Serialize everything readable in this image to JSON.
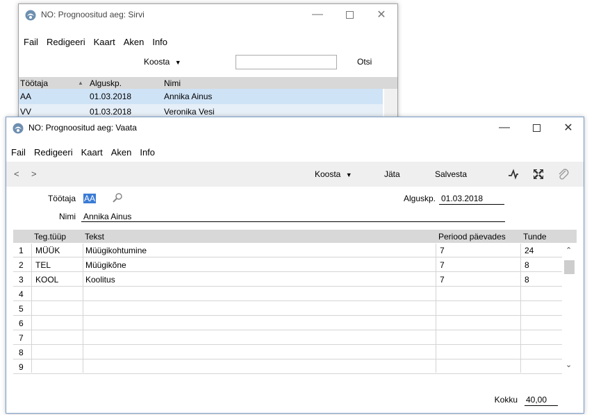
{
  "browse_window": {
    "title": "NO: Prognoositud aeg: Sirvi",
    "menu": [
      "Fail",
      "Redigeeri",
      "Kaart",
      "Aken",
      "Info"
    ],
    "collect_label": "Koosta",
    "search_value": "",
    "search_button": "Otsi",
    "columns": [
      "Töötaja",
      "Alguskp.",
      "Nimi"
    ],
    "rows": [
      {
        "code": "AA",
        "date": "01.03.2018",
        "name": "Annika Ainus"
      },
      {
        "code": "VV",
        "date": "01.03.2018",
        "name": "Veronika Vesi"
      }
    ]
  },
  "view_window": {
    "title": "NO: Prognoositud aeg: Vaata",
    "menu": [
      "Fail",
      "Redigeeri",
      "Kaart",
      "Aken",
      "Info"
    ],
    "toolbar": {
      "prev": "<",
      "next": ">",
      "collect_label": "Koosta",
      "discard_label": "Jäta",
      "save_label": "Salvesta"
    },
    "fields": {
      "employee_label": "Töötaja",
      "employee_value": "AA",
      "start_label": "Alguskp.",
      "start_value": "01.03.2018",
      "name_label": "Nimi",
      "name_value": "Annika Ainus"
    },
    "grid": {
      "columns": [
        "",
        "Teg.tüüp",
        "Tekst",
        "Periood päevades",
        "Tunde"
      ],
      "rows": [
        {
          "n": "1",
          "type": "MÜÜK",
          "text": "Müügikohtumine",
          "period": "7",
          "hours": "24"
        },
        {
          "n": "2",
          "type": "TEL",
          "text": "Müügikõne",
          "period": "7",
          "hours": "8"
        },
        {
          "n": "3",
          "type": "KOOL",
          "text": "Koolitus",
          "period": "7",
          "hours": "8"
        },
        {
          "n": "4",
          "type": "",
          "text": "",
          "period": "",
          "hours": ""
        },
        {
          "n": "5",
          "type": "",
          "text": "",
          "period": "",
          "hours": ""
        },
        {
          "n": "6",
          "type": "",
          "text": "",
          "period": "",
          "hours": ""
        },
        {
          "n": "7",
          "type": "",
          "text": "",
          "period": "",
          "hours": ""
        },
        {
          "n": "8",
          "type": "",
          "text": "",
          "period": "",
          "hours": ""
        },
        {
          "n": "9",
          "type": "",
          "text": "",
          "period": "",
          "hours": ""
        }
      ]
    },
    "total_label": "Kokku",
    "total_value": "40,00"
  },
  "colors": {
    "selection": "#cfe3f7",
    "header_gray": "#d8d8d8",
    "highlight": "#3a7bd5"
  }
}
